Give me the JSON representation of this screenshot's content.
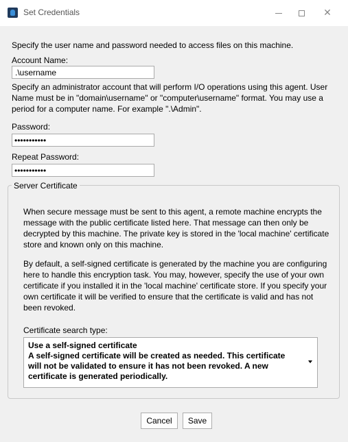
{
  "window": {
    "title": "Set Credentials",
    "icon": "app-icon"
  },
  "form": {
    "intro": "Specify the user name and password needed to access files on this machine.",
    "account_label": "Account Name:",
    "account_value": ".\\username",
    "account_help": "Specify an administrator account that will perform I/O operations using this agent. User Name must be in \"domain\\username\" or \"computer\\username\" format. You may use a period for a computer name. For example \".\\Admin\".",
    "password_label": "Password:",
    "password_value": "•••••••••••",
    "repeat_password_label": "Repeat Password:",
    "repeat_password_value": "•••••••••••"
  },
  "certificate": {
    "group_title": "Server Certificate",
    "para1": "When secure message must be sent to this agent, a remote machine encrypts the message with the public certificate listed here. That message can then only be decrypted by this machine. The private key is stored in the 'local machine' certificate store and known only on this machine.",
    "para2": "By default, a self-signed certificate is generated by the machine you are configuring here to handle this encryption task. You may, however, specify the use of your own certificate if you installed it in the 'local machine' certificate store. If you specify your own certificate it will be verified to ensure that the certificate is valid and has not been revoked.",
    "search_type_label": "Certificate search type:",
    "selected_title": "Use a self-signed certificate",
    "selected_desc": "A self-signed certificate will be created as needed. This certificate will not be validated to ensure it has not been revoked. A new certificate is generated periodically."
  },
  "buttons": {
    "cancel": "Cancel",
    "save": "Save"
  }
}
